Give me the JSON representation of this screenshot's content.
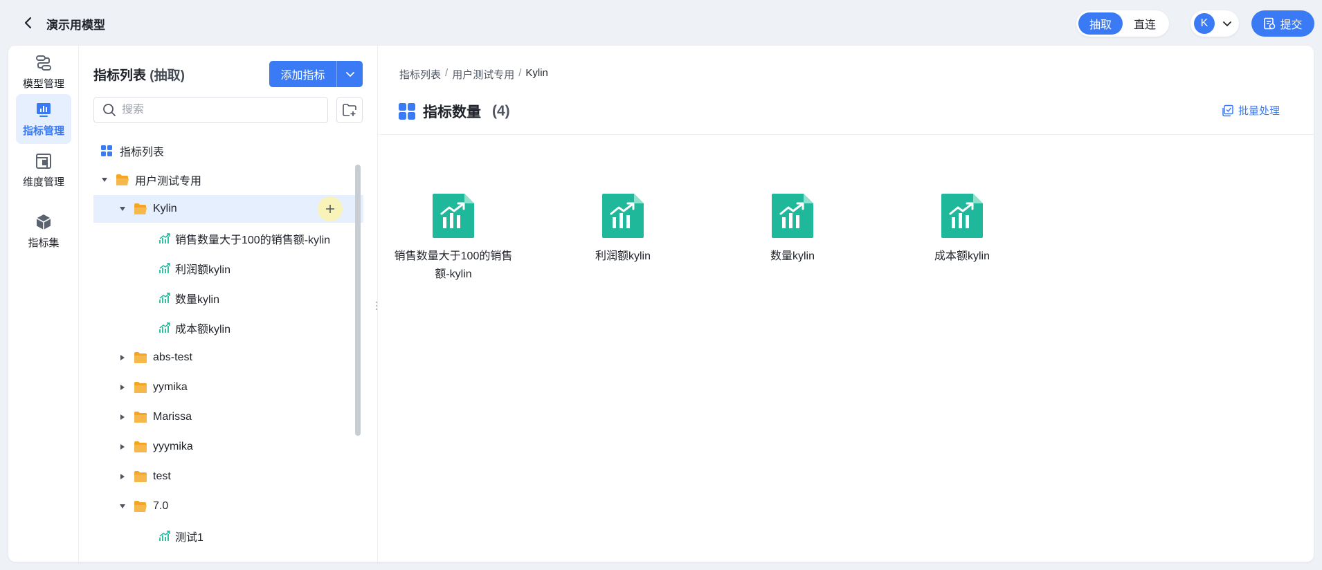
{
  "header": {
    "title": "演示用模型",
    "modes": [
      {
        "label": "抽取",
        "active": true
      },
      {
        "label": "直连",
        "active": false
      }
    ],
    "user_initial": "K",
    "submit_label": "提交"
  },
  "nav": {
    "items": [
      {
        "label": "模型管理",
        "icon": "model-icon",
        "active": false
      },
      {
        "label": "指标管理",
        "icon": "metric-chart-icon",
        "active": true
      },
      {
        "label": "维度管理",
        "icon": "dimension-icon",
        "active": false
      },
      {
        "label": "指标集",
        "icon": "cube-icon",
        "active": false
      }
    ]
  },
  "tree": {
    "title": "指标列表",
    "title_suffix": "(抽取)",
    "add_label": "添加指标",
    "search_placeholder": "搜索",
    "root_label": "指标列表",
    "rows": [
      {
        "label": "用户测试专用",
        "type": "folder",
        "expanded": true
      },
      {
        "label": "Kylin",
        "type": "folder",
        "expanded": true,
        "selected": true
      },
      {
        "label": "销售数量大于100的销售额-kylin",
        "type": "metric"
      },
      {
        "label": "利润额kylin",
        "type": "metric"
      },
      {
        "label": "数量kylin",
        "type": "metric"
      },
      {
        "label": "成本额kylin",
        "type": "metric"
      },
      {
        "label": "abs-test",
        "type": "folder",
        "expanded": false
      },
      {
        "label": "yymika",
        "type": "folder",
        "expanded": false
      },
      {
        "label": "Marissa",
        "type": "folder",
        "expanded": false
      },
      {
        "label": "yyymika",
        "type": "folder",
        "expanded": false
      },
      {
        "label": "test",
        "type": "folder",
        "expanded": false
      },
      {
        "label": "7.0",
        "type": "folder",
        "expanded": true
      },
      {
        "label": "测试1",
        "type": "metric"
      }
    ]
  },
  "content": {
    "breadcrumb": [
      "指标列表",
      "用户测试专用",
      "Kylin"
    ],
    "title": "指标数量",
    "count": "(4)",
    "batch_label": "批量处理",
    "cards": [
      {
        "label": "销售数量大于100的销售额-kylin"
      },
      {
        "label": "利润额kylin"
      },
      {
        "label": "数量kylin"
      },
      {
        "label": "成本额kylin"
      }
    ]
  },
  "colors": {
    "accent": "#3a7bf5",
    "metric_green": "#1fb89a",
    "folder_orange": "#f5a524",
    "nav_active_bg": "#e6effe"
  }
}
